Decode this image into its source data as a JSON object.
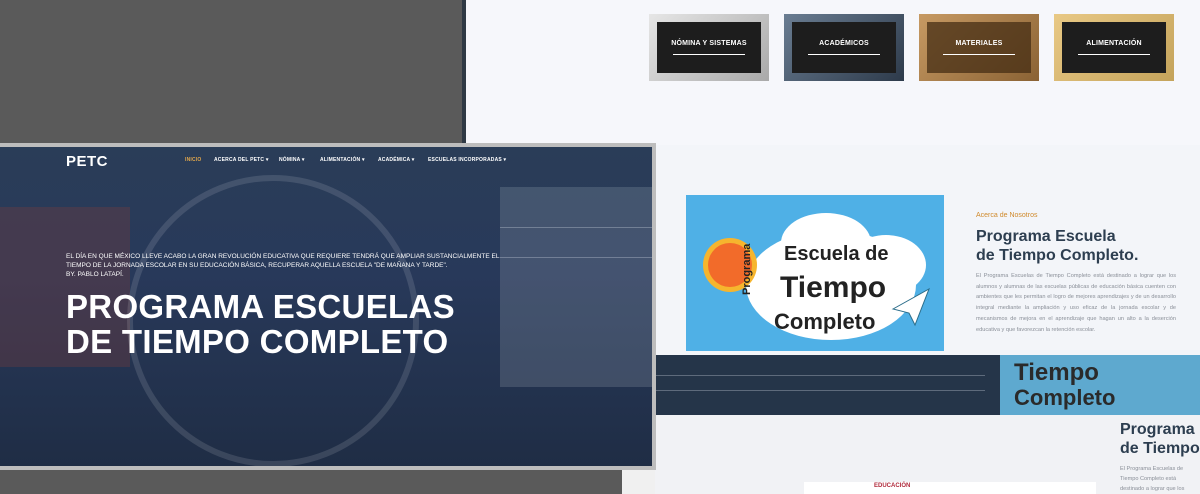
{
  "categories": [
    {
      "label": "NÓMINA Y SISTEMAS",
      "color": "#cfcfcf"
    },
    {
      "label": "ACADÉMICOS",
      "color": "#3f5066"
    },
    {
      "label": "MATERIALES",
      "color": "#b98c55"
    },
    {
      "label": "ALIMENTACIÓN",
      "color": "#d7b070"
    }
  ],
  "about": {
    "eyebrow": "Acerca de Nosotros",
    "title": "Programa Escuela\nde Tiempo Completo.",
    "body": "El Programa Escuelas de Tiempo Completo está destinado a lograr que los alumnos y alumnas de las escuelas públicas de educación básica cuenten con ambientes que les permitan el logro de mejores aprendizajes y de un desarrollo integral mediante la ampliación y uso eficaz de la jornada escolar y de mecanismos de mejora en el aprendizaje que hagan un alto a la deserción educativa y que favorezcan la retención escolar."
  },
  "hero_image": {
    "word1": "Programa",
    "word2": "Escuela de",
    "word3": "Tiempo",
    "word4": "Completo"
  },
  "strip_text": {
    "word1": "Programa",
    "word2": "Tiempo",
    "word3": "Completo"
  },
  "about2": {
    "title": "Programa\nde Tiempo",
    "body": "El Programa Escuelas de Tiempo Completo está destinado a lograr que los alumnos y alumnas de educación básica cuenten"
  },
  "logos": {
    "educacion": "EDUCACIÓN"
  },
  "main": {
    "logo": "PETC",
    "nav": [
      {
        "label": "INICIO",
        "active": true
      },
      {
        "label": "ACERCA DEL PETC ▾"
      },
      {
        "label": "NÓMINA ▾"
      },
      {
        "label": "ALIMENTACIÓN ▾"
      },
      {
        "label": "ACADÉMICA ▾"
      },
      {
        "label": "ESCUELAS INCORPORADAS ▾"
      }
    ],
    "hero_sub": "EL DÍA EN QUE MÉXICO LLEVE ACABO LA GRAN REVOLUCIÓN EDUCATIVA QUE REQUIERE TENDRÁ QUE AMPLIAR SUSTANCIALMENTE EL TIEMPO DE LA JORNADA ESCOLAR EN SU EDUCACIÓN BÁSICA, RECUPERAR AQUELLA ESCUELA \"DE MAÑANA Y TARDE\".\nBY. PABLO LATAPÍ.",
    "hero_title": "PROGRAMA ESCUELAS DE TIEMPO COMPLETO"
  }
}
